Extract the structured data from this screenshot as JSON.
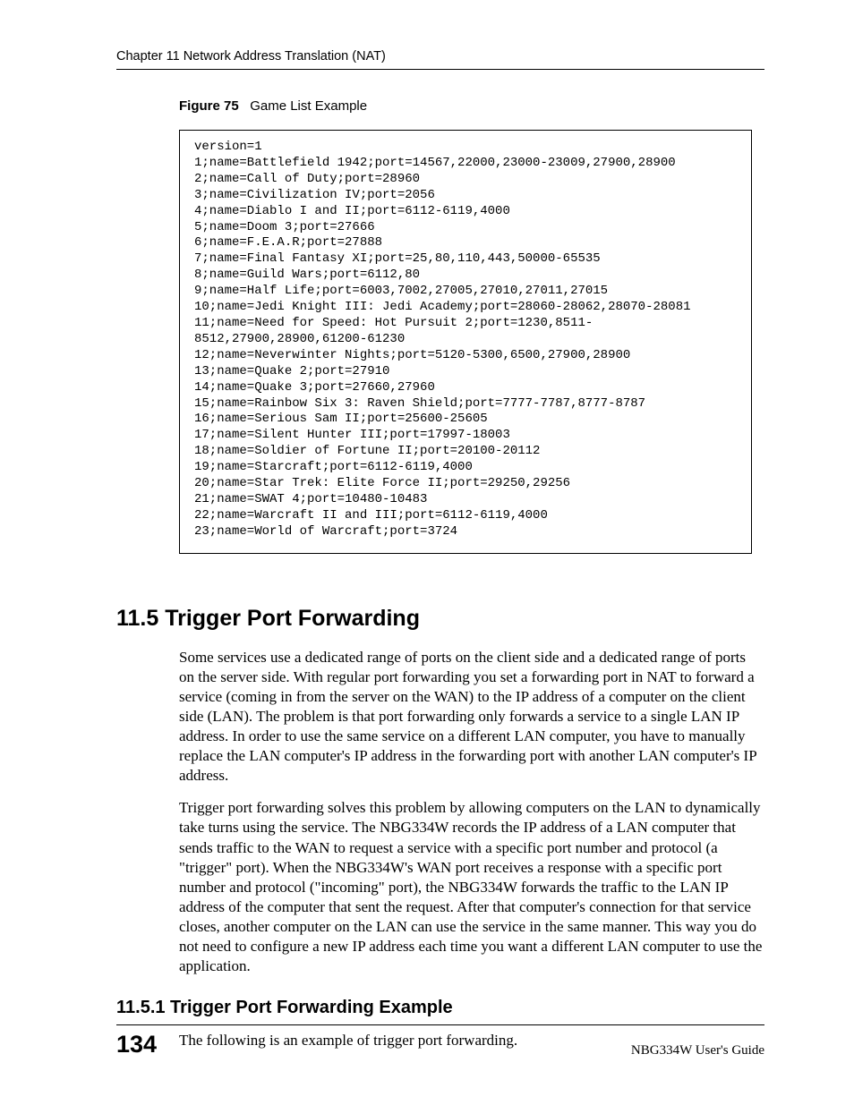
{
  "header": {
    "running": "Chapter 11 Network Address Translation (NAT)"
  },
  "figure": {
    "label": "Figure 75",
    "caption": "Game List Example",
    "code": "version=1\n1;name=Battlefield 1942;port=14567,22000,23000-23009,27900,28900\n2;name=Call of Duty;port=28960\n3;name=Civilization IV;port=2056\n4;name=Diablo I and II;port=6112-6119,4000\n5;name=Doom 3;port=27666\n6;name=F.E.A.R;port=27888\n7;name=Final Fantasy XI;port=25,80,110,443,50000-65535\n8;name=Guild Wars;port=6112,80\n9;name=Half Life;port=6003,7002,27005,27010,27011,27015\n10;name=Jedi Knight III: Jedi Academy;port=28060-28062,28070-28081\n11;name=Need for Speed: Hot Pursuit 2;port=1230,8511-\n8512,27900,28900,61200-61230\n12;name=Neverwinter Nights;port=5120-5300,6500,27900,28900\n13;name=Quake 2;port=27910\n14;name=Quake 3;port=27660,27960\n15;name=Rainbow Six 3: Raven Shield;port=7777-7787,8777-8787\n16;name=Serious Sam II;port=25600-25605\n17;name=Silent Hunter III;port=17997-18003\n18;name=Soldier of Fortune II;port=20100-20112\n19;name=Starcraft;port=6112-6119,4000\n20;name=Star Trek: Elite Force II;port=29250,29256\n21;name=SWAT 4;port=10480-10483\n22;name=Warcraft II and III;port=6112-6119,4000\n23;name=World of Warcraft;port=3724"
  },
  "section": {
    "heading": "11.5  Trigger Port Forwarding",
    "para1": "Some services use a dedicated range of ports on the client side and a dedicated range of ports on the server side. With regular port forwarding you set a forwarding port in NAT to forward a service (coming in from the server on the WAN) to the IP address of a computer on the client side (LAN). The problem is that port forwarding only forwards a service to a single LAN IP address. In order to use the same service on a different LAN computer, you have to manually replace the LAN computer's IP address in the forwarding port with another LAN computer's IP address.",
    "para2": "Trigger port forwarding solves this problem by allowing computers on the LAN to dynamically take turns using the service. The NBG334W records the IP address of a LAN computer that sends traffic to the WAN to request a service with a specific port number and protocol (a \"trigger\" port). When the NBG334W's WAN port receives a response with a specific port number and protocol (\"incoming\" port), the NBG334W forwards the traffic to the LAN IP address of the computer that sent the request. After that computer's connection for that service closes, another computer on the LAN can use the service in the same manner. This way you do not need to configure a new IP address each time you want a different LAN computer to use the application."
  },
  "subsection": {
    "heading": "11.5.1  Trigger Port Forwarding Example",
    "para1": "The following is an example of trigger port forwarding."
  },
  "footer": {
    "page": "134",
    "guide": "NBG334W User's Guide"
  }
}
